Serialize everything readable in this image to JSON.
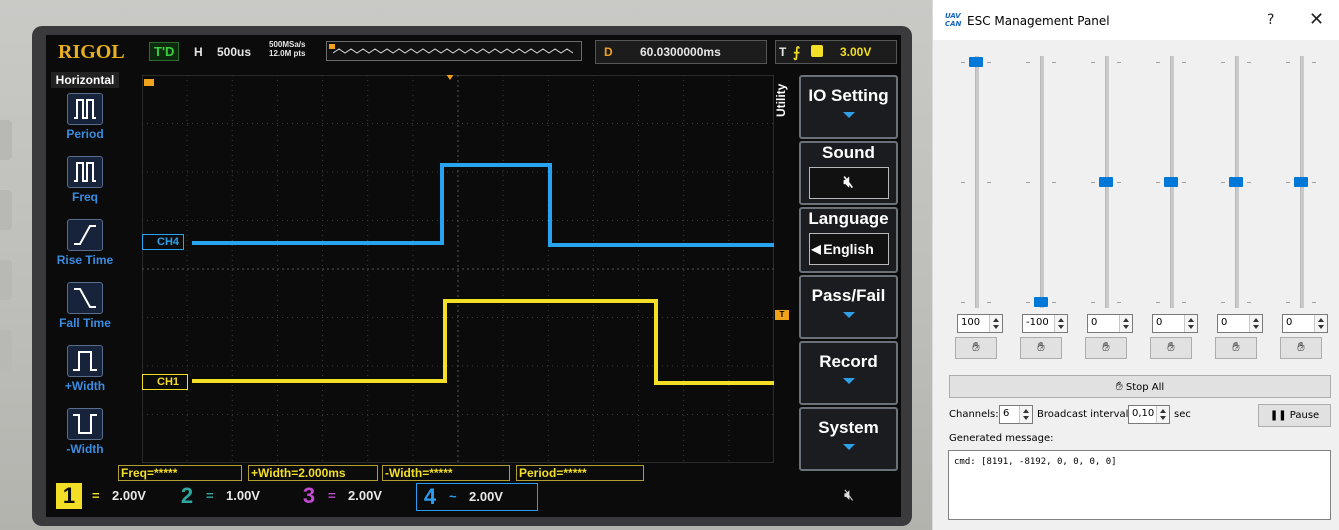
{
  "oscilloscope": {
    "brand": "RIGOL",
    "run_state": "T'D",
    "timebase_label": "H",
    "timebase": "500us",
    "sample_rate": "500MSa/s",
    "memory_depth": "12.0M pts",
    "delay_label": "D",
    "delay": "60.0300000ms",
    "trigger_label": "T",
    "trigger_level": "3.00V",
    "left_menu": {
      "title": "Horizontal",
      "items": [
        {
          "label": "Period",
          "icon": "period-icon"
        },
        {
          "label": "Freq",
          "icon": "freq-icon"
        },
        {
          "label": "Rise Time",
          "icon": "rise-time-icon"
        },
        {
          "label": "Fall Time",
          "icon": "fall-time-icon"
        },
        {
          "label": "+Width",
          "icon": "pos-width-icon"
        },
        {
          "label": "-Width",
          "icon": "neg-width-icon"
        }
      ]
    },
    "right_menu": {
      "utility_label": "Utility",
      "io_setting": "IO Setting",
      "sound": "Sound",
      "language": "Language",
      "language_value": "English",
      "pass_fail": "Pass/Fail",
      "record": "Record",
      "system": "System"
    },
    "channel_tags": {
      "ch4": "CH4",
      "ch1": "CH1",
      "trigger_marker": "T"
    },
    "measurements": {
      "freq": "Freq=*****",
      "pos_width": "+Width=2.000ms",
      "neg_width": "-Width=*****",
      "period": "Period=*****"
    },
    "channels": [
      {
        "num": "1",
        "scale": "2.00V",
        "color": "#f2df26"
      },
      {
        "num": "2",
        "scale": "1.00V",
        "color": "#2fa7a0"
      },
      {
        "num": "3",
        "scale": "2.00V",
        "color": "#c04bd0"
      },
      {
        "num": "4",
        "scale": "2.00V",
        "color": "#2a9cf0"
      }
    ],
    "colors": {
      "ch1": "#f2df26",
      "ch4": "#27a3f0",
      "trigger": "#f0a21b"
    }
  },
  "dialog": {
    "title": "ESC Management Panel",
    "logo_text": "UAV CAN",
    "help": "?",
    "close": "✕",
    "sliders": [
      {
        "value": "100",
        "level": 1.0
      },
      {
        "value": "-100",
        "level": 0.0
      },
      {
        "value": "0",
        "level": 0.5
      },
      {
        "value": "0",
        "level": 0.5
      },
      {
        "value": "0",
        "level": 0.5
      },
      {
        "value": "0",
        "level": 0.5
      }
    ],
    "stop_all": "Stop All",
    "channels_label": "Channels:",
    "channels_value": "6",
    "broadcast_label": "Broadcast interval:",
    "broadcast_value": "0,10",
    "broadcast_unit": "sec",
    "pause": "Pause",
    "generated_label": "Generated message:",
    "message": "cmd: [8191, -8192, 0, 0, 0, 0]"
  }
}
